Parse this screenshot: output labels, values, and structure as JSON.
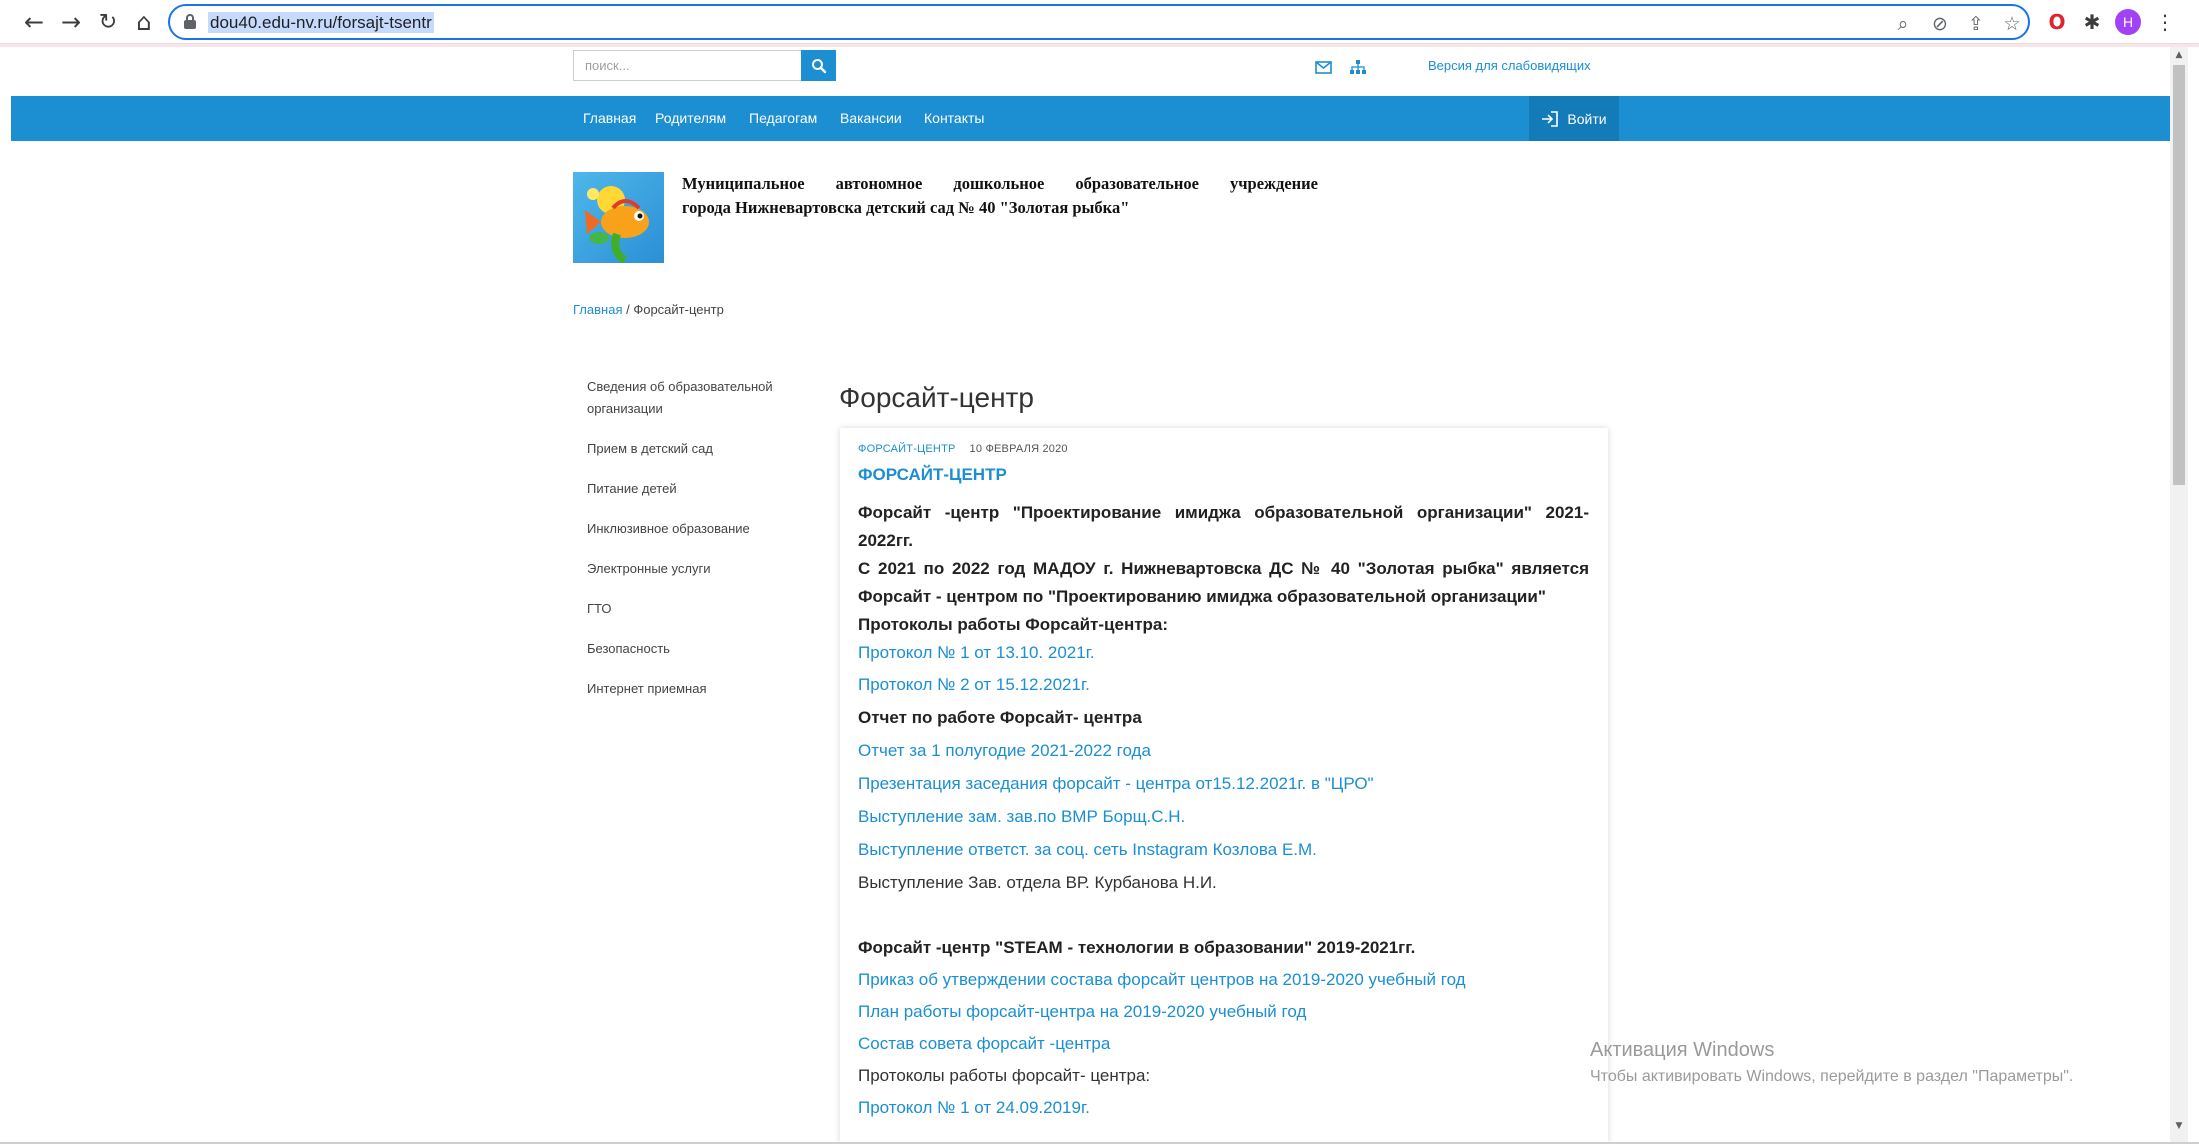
{
  "browser": {
    "url": "dou40.edu-nv.ru/forsajt-tsentr",
    "profile_initial": "H",
    "icons": [
      "back-arrow-icon",
      "forward-arrow-icon",
      "reload-icon",
      "home-icon",
      "lock-icon",
      "zoom-icon",
      "eye-off-icon",
      "share-icon",
      "star-icon",
      "opera-icon",
      "puzzle-icon",
      "menu-dots-icon"
    ]
  },
  "header": {
    "search_placeholder": "поиск...",
    "vision_link": "Версия для слабовидящих"
  },
  "nav": {
    "items": [
      "Главная",
      "Родителям",
      "Педагогам",
      "Вакансии",
      "Контакты"
    ],
    "login": "Войти"
  },
  "org": {
    "name_line1": "Муниципальное автономное дошкольное образовательное учреждение",
    "name_line2": "города Нижневартовска детский сад № 40 \"Золотая рыбка\""
  },
  "breadcrumb": {
    "home": "Главная",
    "separator": " / ",
    "current": "Форсайт-центр"
  },
  "sidebar": {
    "items": [
      "Сведения об образовательной организации",
      "Прием в детский сад",
      "Питание детей",
      "Инклюзивное образование",
      "Электронные услуги",
      "ГТО",
      "Безопасность",
      "Интернет приемная"
    ]
  },
  "page_title": "Форсайт-центр",
  "post": {
    "category": "Форсайт-центр",
    "date": "10 февраля 2020",
    "title": "ФОРСАЙТ-ЦЕНТР",
    "heading1": "Форсайт -центр \"Проектирование имиджа образовательной организации\" 2021-2022гг.",
    "heading2": "С 2021 по 2022 год МАДОУ г. Нижневартовска ДС № 40 \"Золотая рыбка\" является Форсайт - центром по \"Проектированию имиджа образовательной организации\"",
    "protocols_heading": "Протоколы работы Форсайт-центра:",
    "protocol_links": [
      "Протокол № 1 от 13.10. 2021г.",
      "Протокол № 2 от 15.12.2021г."
    ],
    "report_heading": "Отчет по работе Форсайт- центра",
    "report_links": [
      "Отчет за 1 полугодие 2021-2022 года",
      "Презентация заседания форсайт - центра от15.12.2021г. в \"ЦРО\"",
      "Выступление зам. зав.по ВМР Борщ.С.Н.",
      "Выступление  ответст. за соц. сеть Instagram  Козлова Е.М."
    ],
    "report_plain": "Выступление Зав. отдела ВР. Курбанова Н.И.",
    "steam_heading": "Форсайт -центр \"STEAM - технологии в образовании\" 2019-2021гг.",
    "steam_links": [
      "Приказ об утверждении состава форсайт центров на 2019-2020 учебный год",
      "План работы форсайт-центра на 2019-2020 учебный год",
      "Состав совета форсайт -центра"
    ],
    "steam_plain": "Протоколы работы форсайт- центра:",
    "steam_last_link": "Протокол № 1 от 24.09.2019г."
  },
  "activation": {
    "title": "Активация Windows",
    "subtitle": "Чтобы активировать Windows, перейдите в раздел \"Параметры\"."
  },
  "colors": {
    "accent": "#1b8fd1",
    "nav_bg": "#1b8fd1",
    "login_bg": "#137cb8",
    "text": "#222222"
  }
}
